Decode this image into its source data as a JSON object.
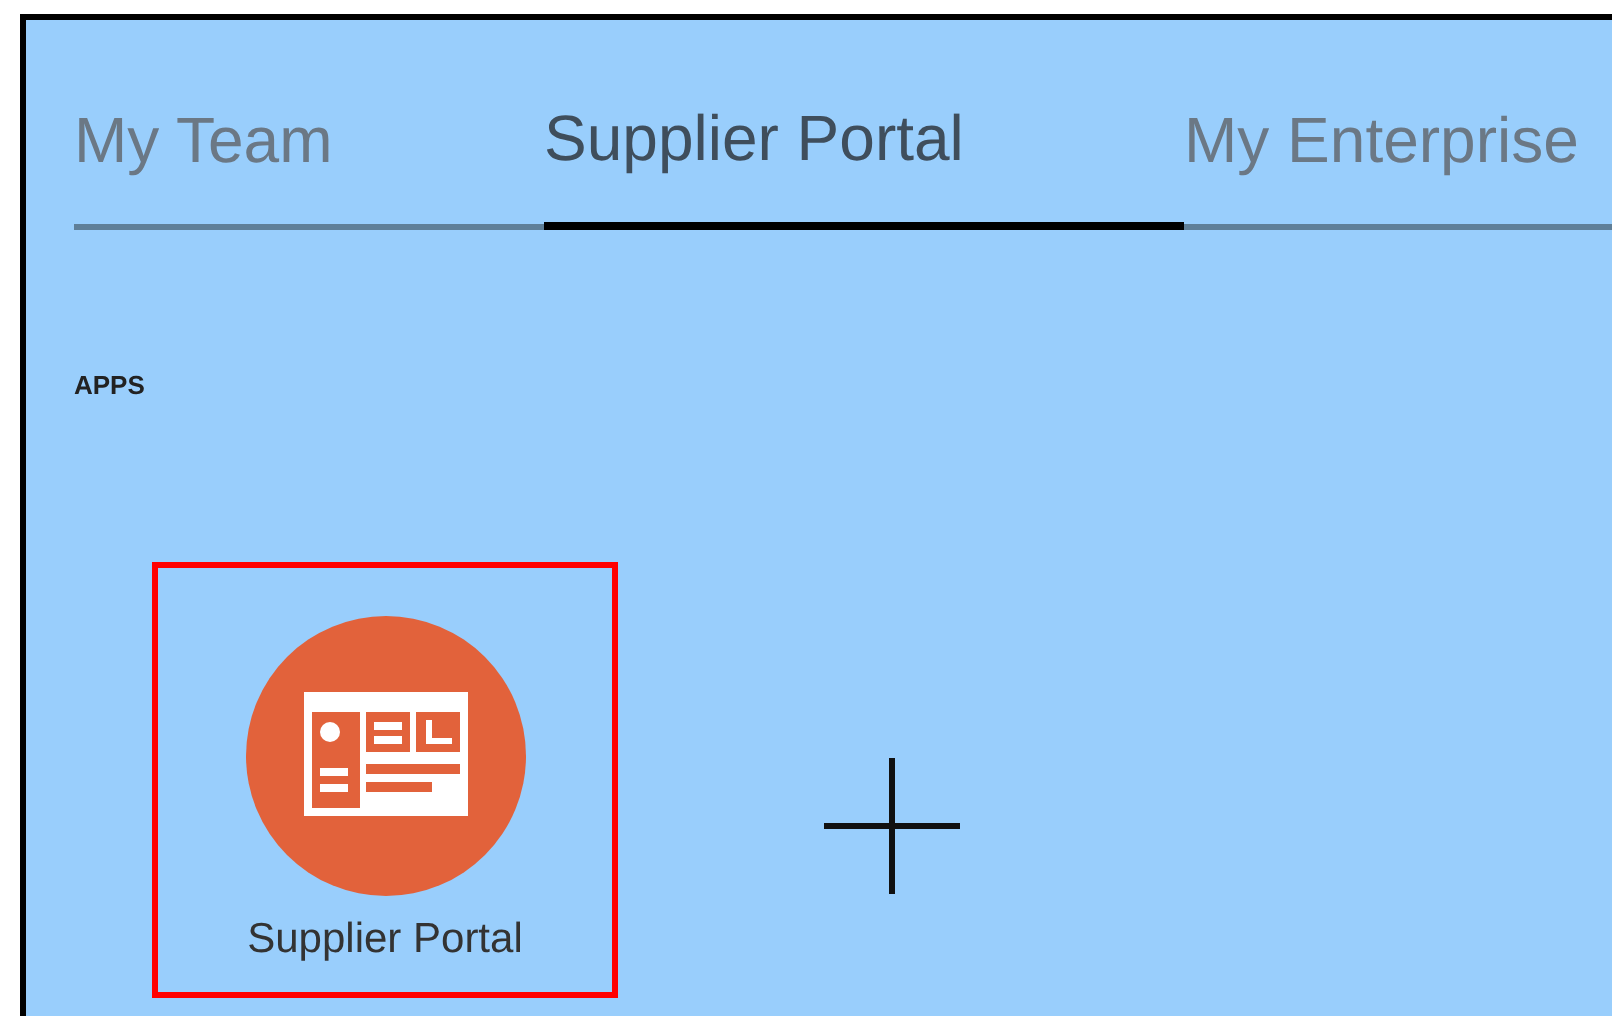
{
  "tabs": [
    {
      "label": "My Team",
      "selected": false
    },
    {
      "label": "Supplier Portal",
      "selected": true
    },
    {
      "label": "My Enterprise",
      "selected": false
    }
  ],
  "section": {
    "title": "APPS"
  },
  "apps": [
    {
      "kind": "app",
      "label": "Supplier Portal",
      "highlighted": true
    },
    {
      "kind": "add",
      "highlighted": false
    }
  ]
}
